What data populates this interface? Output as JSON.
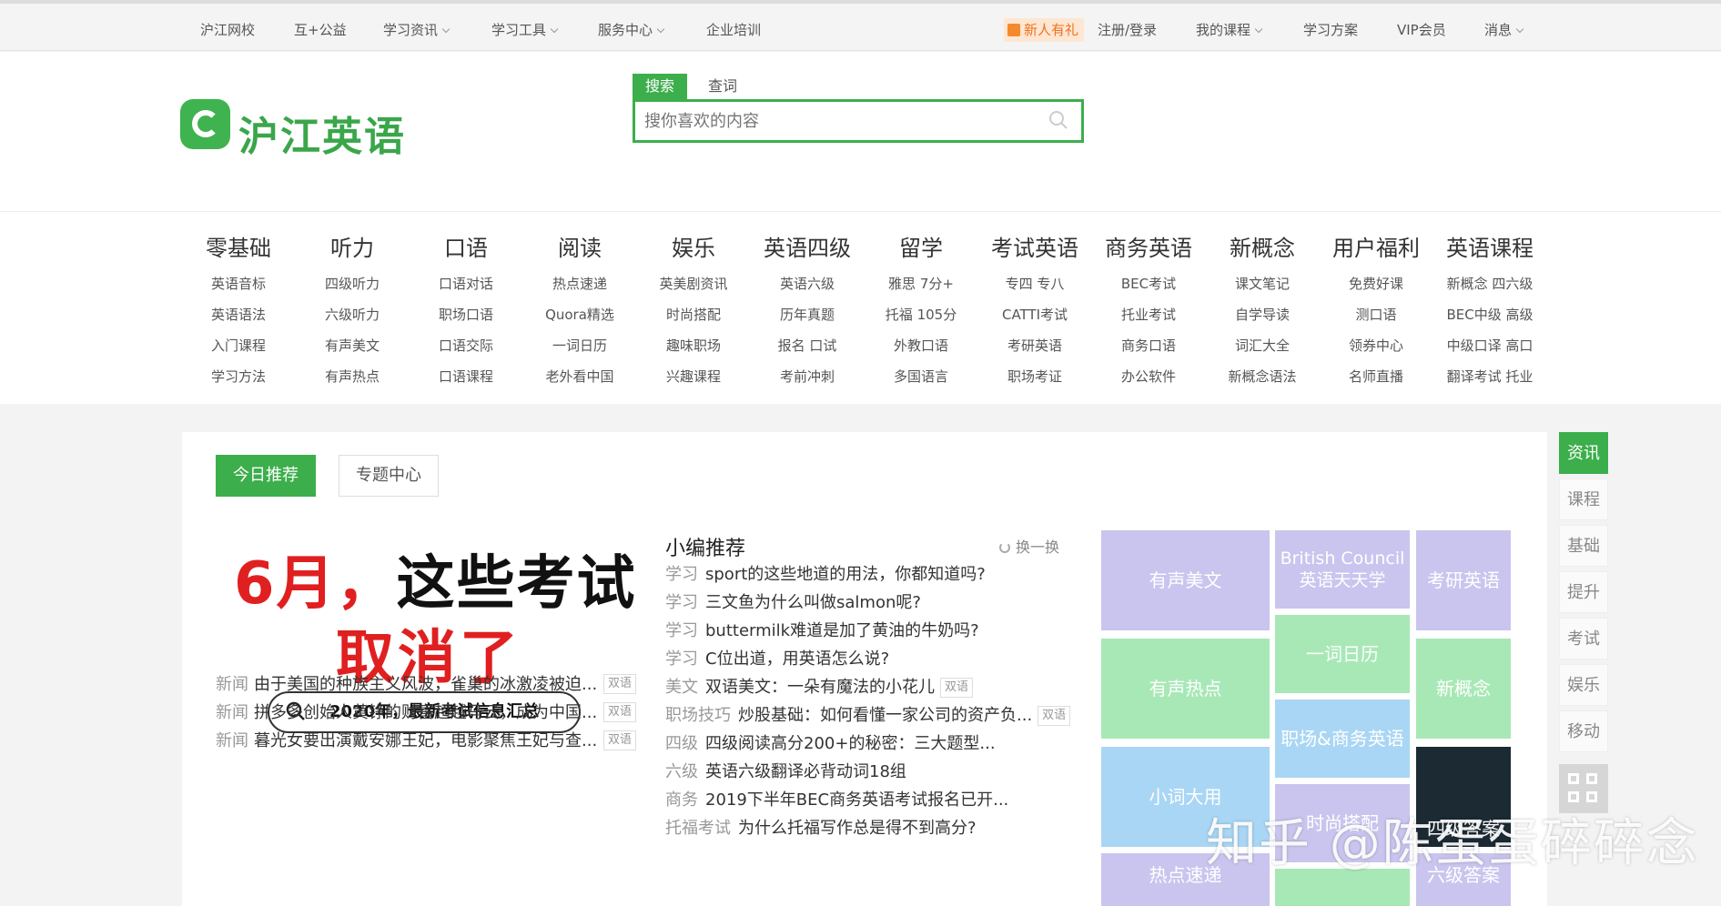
{
  "topbar": {
    "left": [
      "沪江网校",
      "互+公益",
      "学习资讯",
      "学习工具",
      "服务中心",
      "企业培训"
    ],
    "gift": "新人有礼",
    "right": [
      "注册/登录",
      "我的课程",
      "学习方案",
      "VIP会员",
      "消息"
    ]
  },
  "logo": {
    "text": "沪江英语"
  },
  "search": {
    "tab_active": "搜索",
    "tab_other": "查词",
    "placeholder": "搜你喜欢的内容"
  },
  "categories": [
    {
      "head": "零基础",
      "subs": [
        "英语音标",
        "英语语法",
        "入门课程",
        "学习方法"
      ]
    },
    {
      "head": "听力",
      "subs": [
        "四级听力",
        "六级听力",
        "有声美文",
        "有声热点"
      ]
    },
    {
      "head": "口语",
      "subs": [
        "口语对话",
        "职场口语",
        "口语交际",
        "口语课程"
      ]
    },
    {
      "head": "阅读",
      "subs": [
        "热点速递",
        "Quora精选",
        "一词日历",
        "老外看中国"
      ]
    },
    {
      "head": "娱乐",
      "subs": [
        "英美剧资讯",
        "时尚搭配",
        "趣味职场",
        "兴趣课程"
      ]
    },
    {
      "head": "英语四级",
      "subs": [
        "英语六级",
        "历年真题",
        "报名 口试",
        "考前冲刺"
      ]
    },
    {
      "head": "留学",
      "subs": [
        "雅思 7分+",
        "托福 105分",
        "外教口语",
        "多国语言"
      ]
    },
    {
      "head": "考试英语",
      "subs": [
        "专四 专八",
        "CATTI考试",
        "考研英语",
        "职场考证"
      ]
    },
    {
      "head": "商务英语",
      "subs": [
        "BEC考试",
        "托业考试",
        "商务口语",
        "办公软件"
      ]
    },
    {
      "head": "新概念",
      "subs": [
        "课文笔记",
        "自学导读",
        "词汇大全",
        "新概念语法"
      ]
    },
    {
      "head": "用户福利",
      "subs": [
        "免费好课",
        "测口语",
        "领券中心",
        "名师直播"
      ]
    },
    {
      "head": "英语课程",
      "subs": [
        "新概念 四六级",
        "BEC中级 高级",
        "中级口译 高口",
        "翻译考试 托业"
      ]
    }
  ],
  "panel": {
    "tab_today": "今日推荐",
    "tab_topic": "专题中心",
    "banner": {
      "line1_red": "6月，",
      "line1_black": "这些考试",
      "line2": "取消了",
      "pill": "2020年，最新考试信息汇总"
    },
    "news": [
      {
        "cat": "新闻",
        "text": "由于美国的种族主义风波，雀巢的冰激凌被迫...",
        "tag": "双语"
      },
      {
        "cat": "新闻",
        "text": "拼多多创始人黄铮的财富超越马云，成为中国...",
        "tag": "双语"
      },
      {
        "cat": "新闻",
        "text": "暮光女要出演戴安娜王妃，电影聚焦王妃与查...",
        "tag": "双语"
      }
    ],
    "rec_title": "小编推荐",
    "refresh": "换一换",
    "recs": [
      {
        "cat": "学习",
        "text": "sport的这些地道的用法，你都知道吗?",
        "tag": ""
      },
      {
        "cat": "学习",
        "text": "三文鱼为什么叫做salmon呢?",
        "tag": ""
      },
      {
        "cat": "学习",
        "text": "buttermilk难道是加了黄油的牛奶吗?",
        "tag": ""
      },
      {
        "cat": "学习",
        "text": "C位出道，用英语怎么说?",
        "tag": ""
      },
      {
        "cat": "美文",
        "text": "双语美文：一朵有魔法的小花儿",
        "tag": "双语"
      },
      {
        "cat": "职场技巧",
        "text": "炒股基础：如何看懂一家公司的资产负...",
        "tag": "双语"
      },
      {
        "cat": "四级",
        "text": "四级阅读高分200+的秘密：三大题型...",
        "tag": ""
      },
      {
        "cat": "六级",
        "text": "英语六级翻译必背动词18组",
        "tag": ""
      },
      {
        "cat": "商务",
        "text": "2019下半年BEC商务英语考试报名已开...",
        "tag": ""
      },
      {
        "cat": "托福考试",
        "text": "为什么托福写作总是得不到高分?",
        "tag": ""
      }
    ],
    "tiles": [
      "有声美文",
      "British Council 英语天天学",
      "考研英语",
      "有声热点",
      "一词日历",
      "新概念",
      "职场&商务英语",
      "小词大用",
      "时尚搭配",
      "四级答案",
      "热点速递",
      "六级答案"
    ]
  },
  "sidebar": [
    "资讯",
    "课程",
    "基础",
    "提升",
    "考试",
    "娱乐",
    "移动"
  ],
  "watermark": "知乎 @陈蛋蛋碎碎念",
  "colors": {
    "accent": "#3cae4c",
    "tile_purple": "#c9c5ee",
    "tile_green": "#a8e8b6",
    "tile_blue": "#a9d6f4"
  }
}
